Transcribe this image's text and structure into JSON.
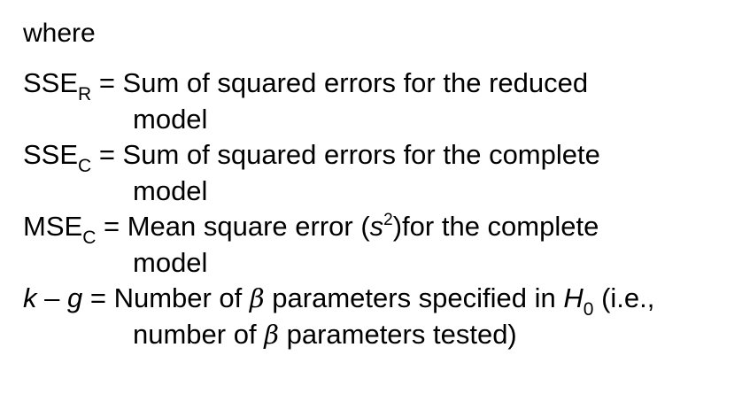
{
  "intro": "where",
  "definitions": [
    {
      "term_base": "SSE",
      "term_sub": "R",
      "eq": " = ",
      "desc_line1": "Sum of squared errors for the reduced",
      "desc_line2": "model"
    },
    {
      "term_base": "SSE",
      "term_sub": "C",
      "eq": " = ",
      "desc_line1": "Sum of squared errors for the complete",
      "desc_line2": "model"
    },
    {
      "term_base": "MSE",
      "term_sub": "C",
      "eq": " = ",
      "desc_a": "Mean square error (",
      "desc_s": "s",
      "desc_sup": "2",
      "desc_b": ")for the complete",
      "desc_line2": "model"
    },
    {
      "term_k": "k",
      "term_dash": " – ",
      "term_g": "g",
      "eq": " = ",
      "desc_a": "Number of ",
      "beta": "β",
      "desc_b": " parameters specified in ",
      "h": "H",
      "h_sub": "0",
      "desc_c": " (i.e.,",
      "line2_a": "number of ",
      "line2_beta": "β",
      "line2_b": " parameters tested)"
    }
  ]
}
